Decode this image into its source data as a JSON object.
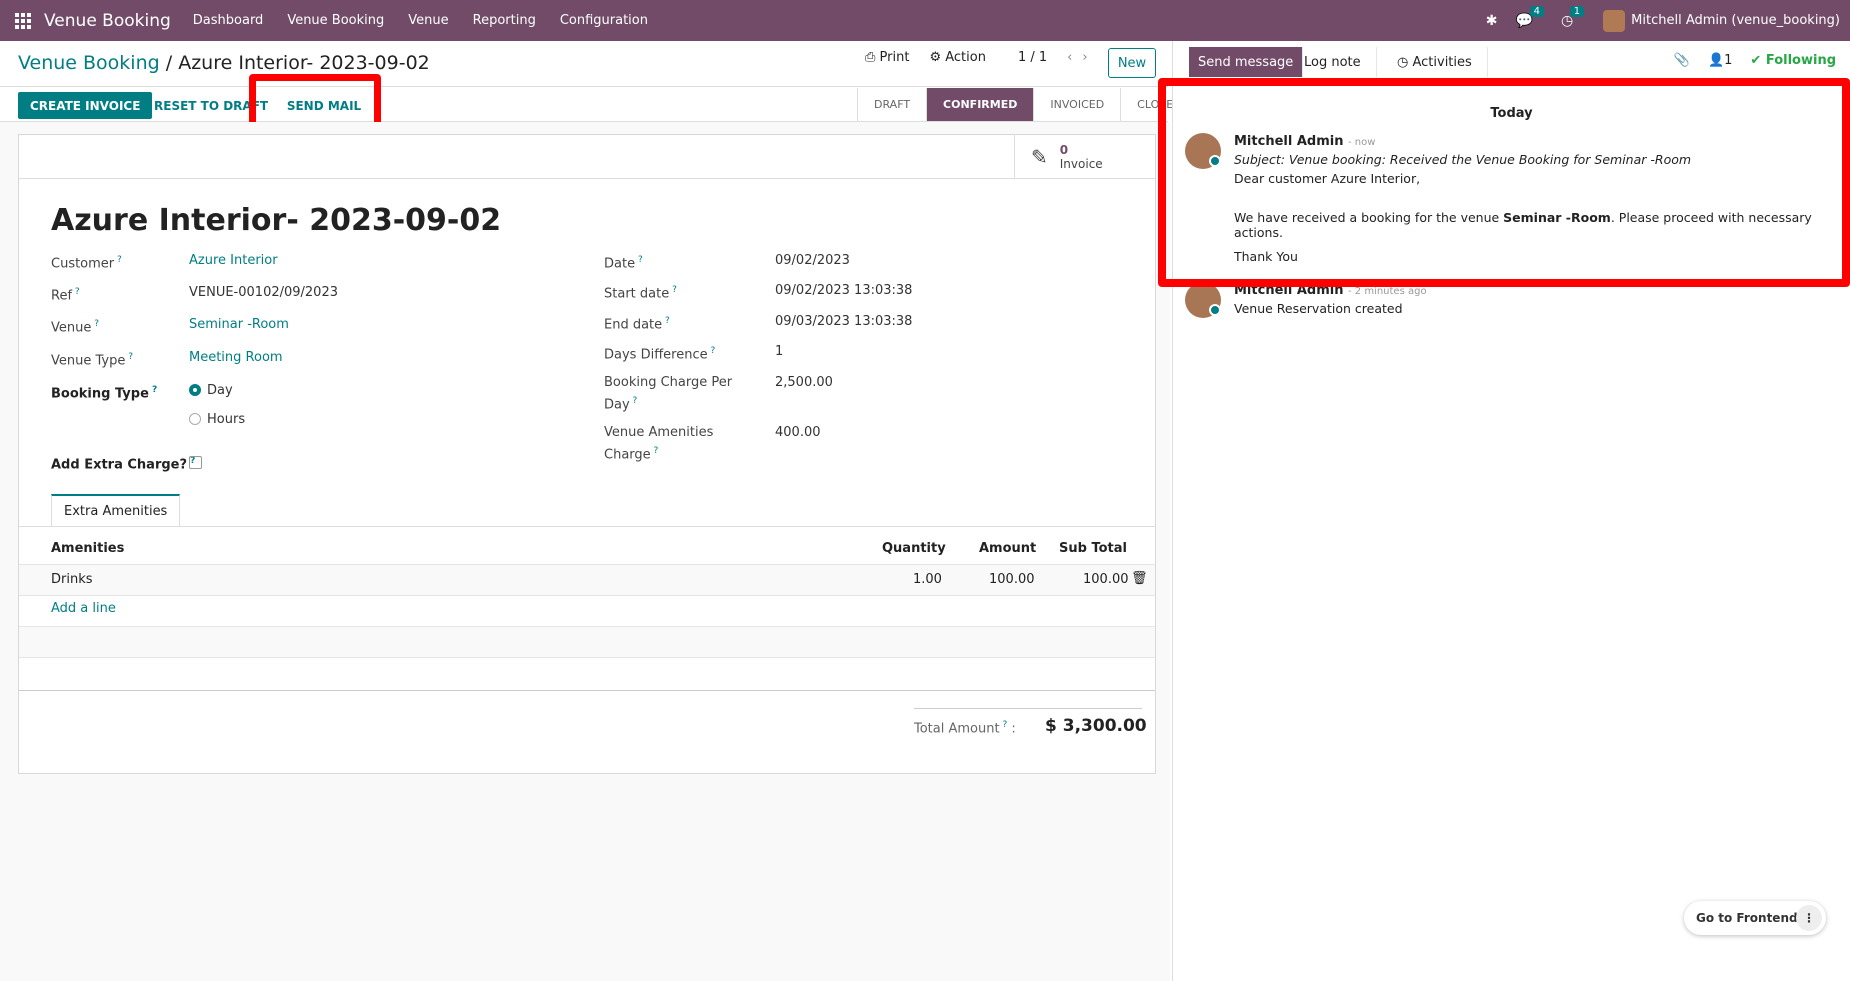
{
  "navbar": {
    "brand": "Venue Booking",
    "menus": [
      "Dashboard",
      "Venue Booking",
      "Venue",
      "Reporting",
      "Configuration"
    ],
    "messages_count": "4",
    "activities_count": "1",
    "user": "Mitchell Admin (venue_booking)"
  },
  "breadcrumb": {
    "parent": "Venue Booking",
    "separator": "/",
    "current": "Azure Interior- 2023-09-02"
  },
  "control": {
    "print": "Print",
    "action": "Action",
    "pager": "1 / 1",
    "new": "New"
  },
  "actions": {
    "create_invoice": "CREATE INVOICE",
    "reset_to_draft": "RESET TO DRAFT",
    "send_mail": "SEND MAIL"
  },
  "stages": [
    "DRAFT",
    "CONFIRMED",
    "INVOICED",
    "CLOSE"
  ],
  "active_stage": "CONFIRMED",
  "smart_button": {
    "value": "0",
    "label": "Invoice"
  },
  "form": {
    "title": "Azure Interior- 2023-09-02",
    "left": {
      "customer_label": "Customer",
      "customer": "Azure Interior",
      "ref_label": "Ref",
      "ref": "VENUE-00102/09/2023",
      "venue_label": "Venue",
      "venue": "Seminar -Room",
      "venue_type_label": "Venue Type",
      "venue_type": "Meeting Room",
      "booking_type_label": "Booking Type",
      "booking_day": "Day",
      "booking_hours": "Hours",
      "extra_charge_label": "Add Extra Charge?"
    },
    "right": {
      "date_label": "Date",
      "date": "09/02/2023",
      "start_label": "Start date",
      "start": "09/02/2023 13:03:38",
      "end_label": "End date",
      "end": "09/03/2023 13:03:38",
      "days_label": "Days Difference",
      "days": "1",
      "charge_label_1": "Booking Charge Per",
      "charge_label_2": "Day",
      "charge": "2,500.00",
      "amenities_label_1": "Venue Amenities",
      "amenities_label_2": "Charge",
      "amenities_charge": "400.00"
    },
    "tab": "Extra Amenities",
    "table": {
      "headers": {
        "amenities": "Amenities",
        "quantity": "Quantity",
        "amount": "Amount",
        "subtotal": "Sub Total"
      },
      "rows": [
        {
          "amenity": "Drinks",
          "quantity": "1.00",
          "amount": "100.00",
          "subtotal": "100.00"
        }
      ],
      "add_line": "Add a line"
    },
    "total_label": "Total Amount",
    "total": "$ 3,300.00"
  },
  "chatter": {
    "send_message": "Send message",
    "log_note": "Log note",
    "activities": "Activities",
    "followers": "1",
    "following": "Following",
    "date_header": "Today",
    "messages": [
      {
        "author": "Mitchell Admin",
        "time": "- now",
        "subject": "Subject: Venue booking: Received the Venue Booking for Seminar -Room",
        "greeting": "Dear customer Azure Interior,",
        "body_pre": "We have received a booking for the venue ",
        "body_bold": "Seminar -Room",
        "body_post": ". Please proceed with necessary actions.",
        "closing": "Thank You"
      },
      {
        "author": "Mitchell Admin",
        "time": "- 2 minutes ago",
        "body": "Venue Reservation created"
      }
    ]
  },
  "frontend_button": "Go to Frontend",
  "colors": {
    "brand": "#714B67",
    "accent": "#017e84",
    "highlight": "#ff0000",
    "following": "#28a745"
  }
}
